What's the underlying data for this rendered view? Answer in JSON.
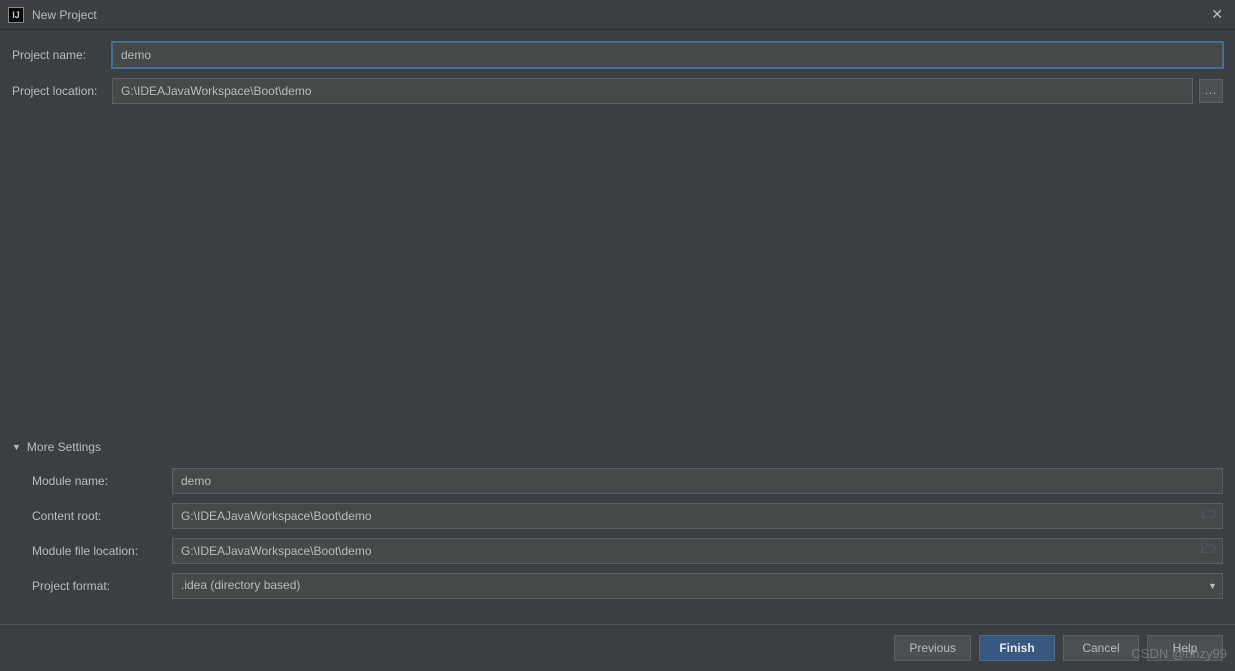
{
  "window": {
    "title": "New Project"
  },
  "form": {
    "project_name_label": "Project name:",
    "project_name_value": "demo",
    "project_location_label": "Project location:",
    "project_location_value": "G:\\IDEAJavaWorkspace\\Boot\\demo",
    "browse_label": "..."
  },
  "more_settings": {
    "header": "More Settings",
    "module_name_label": "Module name:",
    "module_name_value": "demo",
    "content_root_label": "Content root:",
    "content_root_value": "G:\\IDEAJavaWorkspace\\Boot\\demo",
    "module_file_location_label": "Module file location:",
    "module_file_location_value": "G:\\IDEAJavaWorkspace\\Boot\\demo",
    "project_format_label": "Project format:",
    "project_format_value": ".idea (directory based)"
  },
  "buttons": {
    "previous": "Previous",
    "finish": "Finish",
    "cancel": "Cancel",
    "help": "Help"
  },
  "watermark": "CSDN @hhzy99"
}
